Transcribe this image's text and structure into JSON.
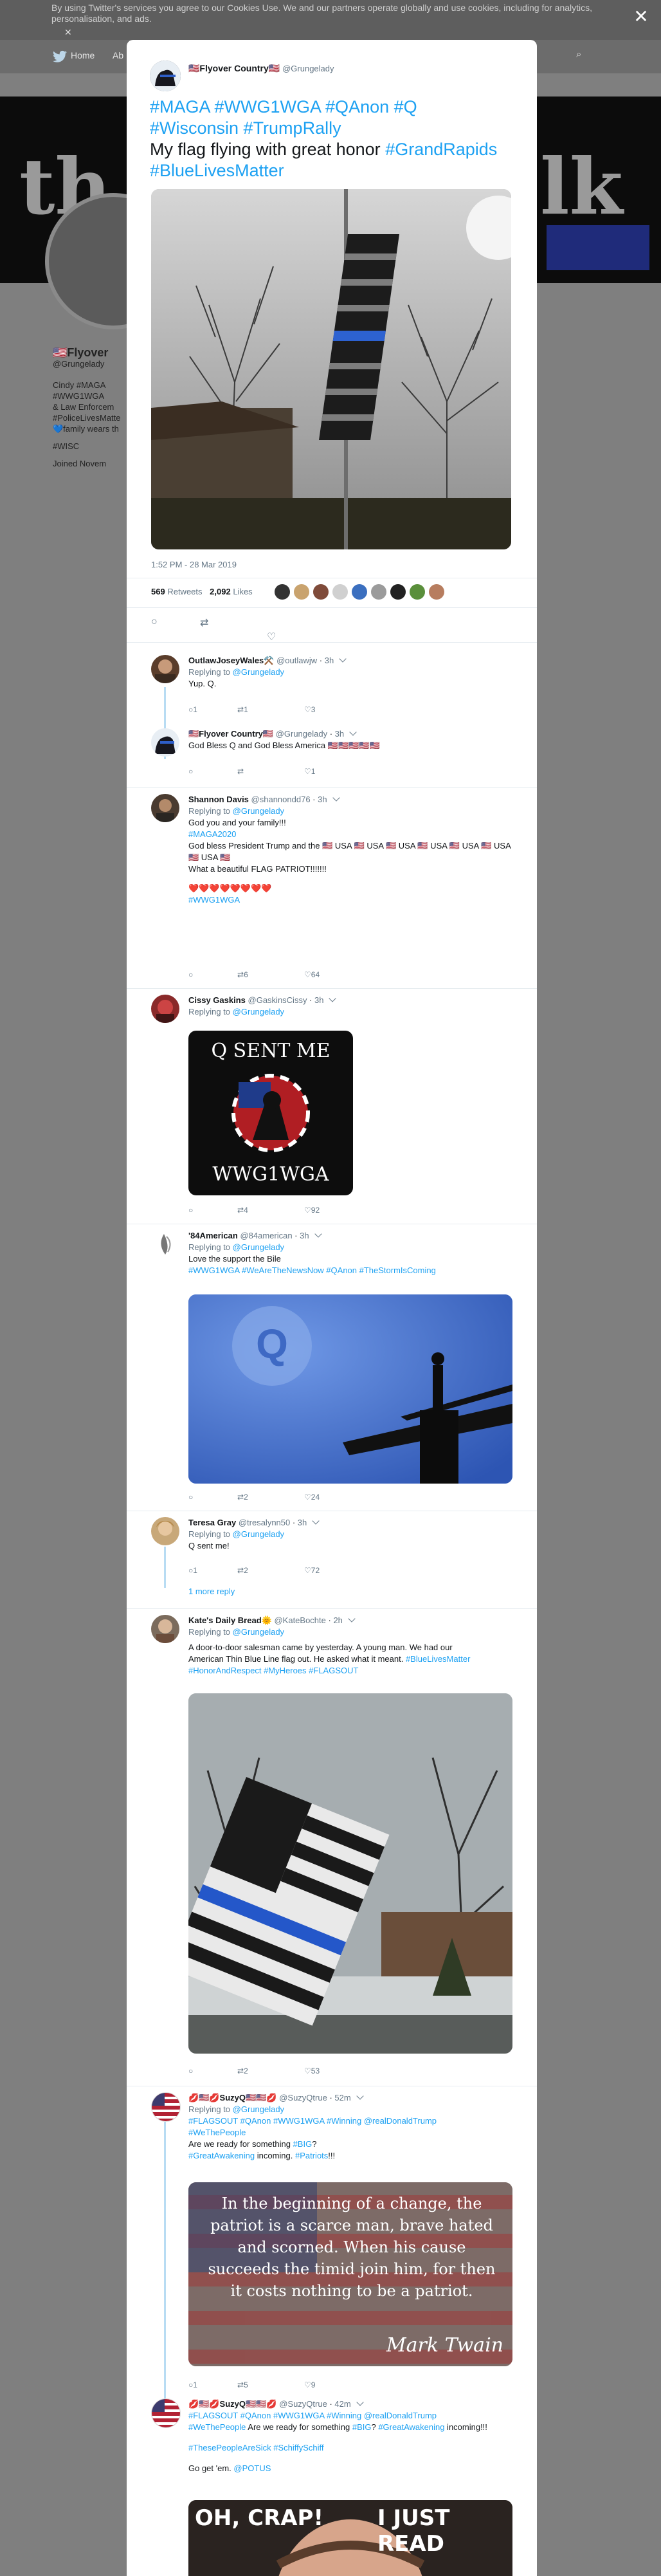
{
  "cookie_bar": {
    "text": "By using Twitter's services you agree to our Cookies Use. We and our partners operate globally and use cookies, including for analytics, personalisation, and ads."
  },
  "nav": {
    "home": "Home",
    "about": "Ab"
  },
  "background_profile": {
    "name": "🇺🇸Flyover",
    "handle": "@Grungelady",
    "bio_line1": "Cindy #MAGA",
    "bio_line2": "#WWG1WGA",
    "bio_line3": "& Law Enforcem",
    "bio_line4": "#PoliceLivesMatte",
    "bio_line5": "💙family wears th",
    "location": "#WISC",
    "joined": "Joined Novem"
  },
  "tweet": {
    "author_name": "🇺🇸Flyover Country🇺🇸",
    "author_handle": "@Grungelady",
    "text_line1": "#MAGA #WWG1WGA #QAnon #Q",
    "text_line2": "#Wisconsin #TrumpRally",
    "text_line3_plain": "My flag flying with great honor ",
    "text_line3_tag": "#GrandRapids",
    "text_line4": "#BlueLivesMatter",
    "timestamp": "1:52 PM - 28 Mar 2019",
    "retweets_count": "569",
    "retweets_label": "Retweets",
    "likes_count": "2,092",
    "likes_label": "Likes"
  },
  "replies": [
    {
      "name": "OutlawJoseyWales⚒️",
      "handle": "@outlawjw",
      "time": "3h",
      "replying_prefix": "Replying to ",
      "replying_to": "@Grungelady",
      "text": "Yup. Q.",
      "replies": "1",
      "retweets": "1",
      "likes": "3"
    },
    {
      "name": "🇺🇸Flyover Country🇺🇸",
      "handle": "@Grungelady",
      "time": "3h",
      "text": "God Bless Q and God Bless America 🇺🇸🇺🇸🇺🇸🇺🇸🇺🇸",
      "replies": "",
      "retweets": "",
      "likes": "1"
    },
    {
      "name": "Shannon Davis",
      "handle": "@shannondd76",
      "time": "3h",
      "replying_prefix": "Replying to ",
      "replying_to": "@Grungelady",
      "line1": "God you and your family!!!",
      "line2": "#MAGA2020",
      "line3": "God bless President Trump and the 🇺🇸 USA 🇺🇸 USA 🇺🇸 USA 🇺🇸 USA 🇺🇸 USA 🇺🇸 USA 🇺🇸 USA 🇺🇸",
      "line4": "What a beautiful FLAG PATRIOT!!!!!!!",
      "hearts": "❤️❤️❤️❤️❤️❤️❤️❤️",
      "line5": "#WWG1WGA",
      "replies": "",
      "retweets": "6",
      "likes": "64"
    },
    {
      "name": "Cissy Gaskins",
      "handle": "@GaskinsCissy",
      "time": "3h",
      "replying_prefix": "Replying to ",
      "replying_to": "@Grungelady",
      "image_top": "Q SENT ME",
      "image_bottom": "WWG1WGA",
      "replies": "",
      "retweets": "4",
      "likes": "92"
    },
    {
      "name": "'84American",
      "handle": "@84american",
      "time": "3h",
      "replying_prefix": "Replying to ",
      "replying_to": "@Grungelady",
      "line1": "Love the support the Bile",
      "line2": "#WWG1WGA #WeAreTheNewsNow #QAnon #TheStormIsComing",
      "image_letter": "Q",
      "replies": "",
      "retweets": "2",
      "likes": "24"
    },
    {
      "name": "Teresa Gray",
      "handle": "@tresalynn50",
      "time": "3h",
      "replying_prefix": "Replying to ",
      "replying_to": "@Grungelady",
      "text": "Q sent me!",
      "replies": "1",
      "retweets": "2",
      "likes": "72",
      "more": "1 more reply"
    },
    {
      "name": "Kate's Daily Bread🌞",
      "handle": "@KateBochte",
      "time": "2h",
      "replying_prefix": "Replying to ",
      "replying_to": "@Grungelady",
      "line1": "A door-to-door salesman came by yesterday. A young man. We had our",
      "line2_plain": "American Thin Blue Line flag out. He asked what it meant. ",
      "line2_tag": "#BlueLivesMatter",
      "line3": "#HonorAndRespect #MyHeroes #FLAGSOUT",
      "replies": "",
      "retweets": "2",
      "likes": "53"
    },
    {
      "name": "💋🇺🇸💋SuzyQ🇺🇸🇺🇸💋",
      "handle": "@SuzyQtrue",
      "time": "52m",
      "replying_prefix": "Replying to ",
      "replying_to": "@Grungelady",
      "line1": "#FLAGSOUT #QAnon #WWG1WGA #Winning @realDonaldTrump",
      "line2": "#WeThePeople",
      "line3_plain": "Are we ready for something ",
      "line3_tag": "#BIG",
      "line3_end": "?",
      "line4_tag": "#GreatAwakening",
      "line4_plain": " incoming. ",
      "line4_tag2": "#Patriots",
      "line4_end": "!!!",
      "quote_text": "In the beginning of a change, the patriot is a scarce man, brave hated and scorned. When his cause succeeds the timid join him, for then it costs nothing to be a patriot.",
      "quote_author": "Mark Twain",
      "replies": "1",
      "retweets": "5",
      "likes": "9"
    },
    {
      "name": "💋🇺🇸💋SuzyQ🇺🇸🇺🇸💋",
      "handle": "@SuzyQtrue",
      "time": "42m",
      "line1": "#FLAGSOUT #QAnon #WWG1WGA #Winning @realDonaldTrump",
      "line2_tag": "#WeThePeople",
      "line2_plain": " Are we ready for something ",
      "line2_tag2": "#BIG",
      "line2_mid": "? ",
      "line2_tag3": "#GreatAwakening",
      "line2_end": " incoming!!!",
      "line3": "#ThesePeopleAreSick #SchiffySchiff",
      "line4": "Go get 'em. ",
      "line4_tag": "@POTUS",
      "meme_left": "OH, CRAP!",
      "meme_right": "I JUST READ"
    }
  ],
  "colors": {
    "link": "#1da1f2",
    "muted": "#657786",
    "thread": "#b8dcf3"
  }
}
